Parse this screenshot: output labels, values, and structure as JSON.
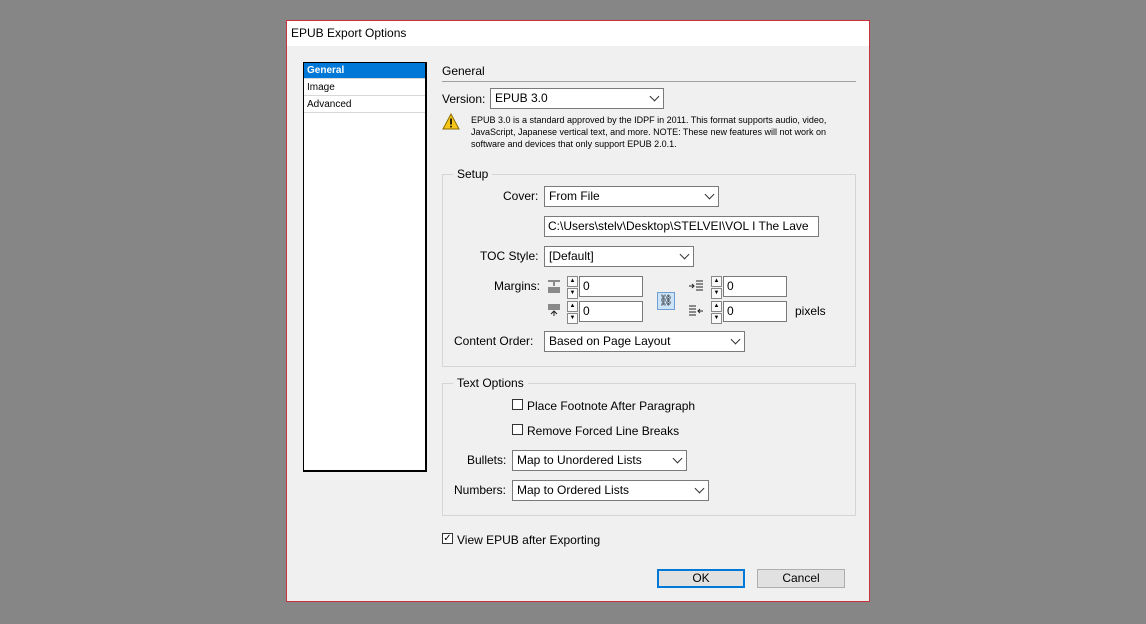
{
  "window": {
    "title": "EPUB Export Options"
  },
  "sidebar": {
    "items": [
      {
        "label": "General"
      },
      {
        "label": "Image"
      },
      {
        "label": "Advanced"
      }
    ]
  },
  "general": {
    "section_title": "General",
    "version_label": "Version:",
    "version_value": "EPUB 3.0",
    "note": "EPUB 3.0 is a standard approved by the IDPF in 2011. This format supports audio, video, JavaScript, Japanese vertical text, and more. NOTE: These new features will not work on software and devices that only support EPUB 2.0.1."
  },
  "setup": {
    "legend": "Setup",
    "cover_label": "Cover:",
    "cover_value": "From File",
    "cover_path": "C:\\Users\\stelv\\Desktop\\STELVEI\\VOL I The Lave",
    "toc_label": "TOC Style:",
    "toc_value": "[Default]",
    "margins_label": "Margins:",
    "margin_top": "0",
    "margin_bottom": "0",
    "margin_left": "0",
    "margin_right": "0",
    "margin_unit": "pixels",
    "content_order_label": "Content Order:",
    "content_order_value": "Based on Page Layout"
  },
  "text_options": {
    "legend": "Text Options",
    "footnote_label": "Place Footnote After Paragraph",
    "footnote_checked": false,
    "forced_breaks_label": "Remove Forced Line Breaks",
    "forced_breaks_checked": false,
    "bullets_label": "Bullets:",
    "bullets_value": "Map to Unordered Lists",
    "numbers_label": "Numbers:",
    "numbers_value": "Map to Ordered Lists"
  },
  "view_after": {
    "label": "View EPUB after Exporting",
    "checked": true
  },
  "buttons": {
    "ok": "OK",
    "cancel": "Cancel"
  }
}
